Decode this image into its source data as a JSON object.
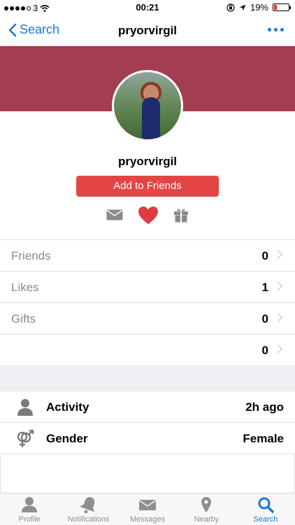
{
  "status_bar": {
    "carrier": "3",
    "time": "00:21",
    "battery": "19%",
    "battery_level": 0.19
  },
  "nav": {
    "back_label": "Search",
    "title": "pryorvirgil"
  },
  "profile": {
    "username": "pryorvirgil",
    "add_friends_label": "Add to Friends"
  },
  "stats": [
    {
      "label": "Friends",
      "value": "0"
    },
    {
      "label": "Likes",
      "value": "1"
    },
    {
      "label": "Gifts",
      "value": "0"
    },
    {
      "label": "",
      "value": "0"
    }
  ],
  "info": {
    "activity": {
      "label": "Activity",
      "value": "2h ago"
    },
    "gender": {
      "label": "Gender",
      "value": "Female"
    }
  },
  "tabs": [
    {
      "label": "Profile",
      "icon": "person-icon"
    },
    {
      "label": "Notifications",
      "icon": "bell-icon"
    },
    {
      "label": "Messages",
      "icon": "envelope-icon"
    },
    {
      "label": "Nearby",
      "icon": "location-pin-icon"
    },
    {
      "label": "Search",
      "icon": "search-icon"
    }
  ],
  "colors": {
    "accent": "#1a78d6",
    "banner": "#a33e52",
    "button": "#e34545",
    "heart": "#e03a44"
  }
}
